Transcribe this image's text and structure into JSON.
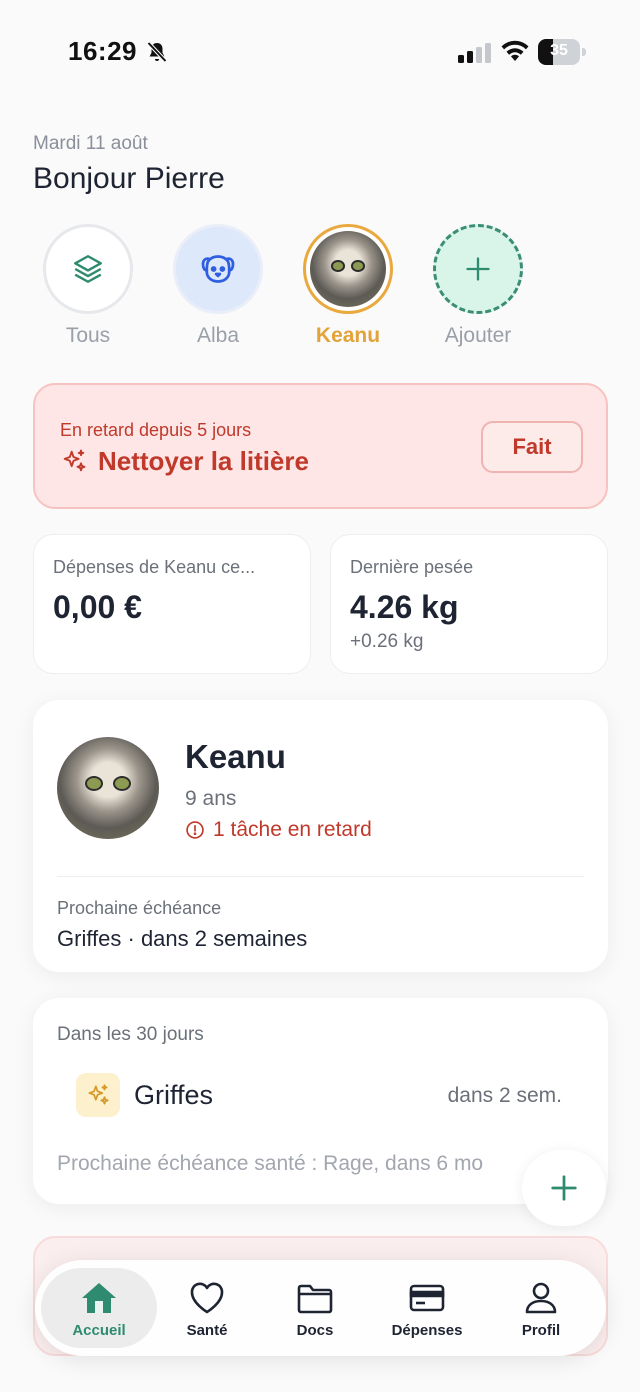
{
  "status_bar": {
    "time": "16:29",
    "battery": "35",
    "battery_level": 0.35
  },
  "header": {
    "date": "Mardi 11 août",
    "greeting": "Bonjour Pierre"
  },
  "pets": [
    {
      "label": "Tous",
      "icon": "layers-icon",
      "active": false
    },
    {
      "label": "Alba",
      "icon": "dog-face-icon",
      "active": false
    },
    {
      "label": "Keanu",
      "icon": "cat-photo",
      "active": true
    },
    {
      "label": "Ajouter",
      "icon": "plus-icon",
      "active": false
    }
  ],
  "alert": {
    "subtitle": "En retard depuis 5 jours",
    "title": "Nettoyer la litière",
    "icon": "sparkles-icon",
    "button": "Fait"
  },
  "stats": [
    {
      "label": "Dépenses de Keanu ce...",
      "value": "0,00 €"
    },
    {
      "label": "Dernière pesée",
      "value": "4.26 kg",
      "delta": "+0.26 kg"
    }
  ],
  "profile": {
    "name": "Keanu",
    "age": "9 ans",
    "warning": "1 tâche en retard",
    "next_label": "Prochaine échéance",
    "next_value": "Griffes · dans 2 semaines"
  },
  "upcoming": {
    "title": "Dans les 30 jours",
    "items": [
      {
        "name": "Griffes",
        "when": "dans 2 sem.",
        "icon": "sparkles-icon"
      }
    ],
    "note": "Prochaine échéance santé : Rage, dans 6 mo"
  },
  "tabs": [
    {
      "label": "Accueil",
      "icon": "home-icon",
      "active": true
    },
    {
      "label": "Santé",
      "icon": "heart-icon",
      "active": false
    },
    {
      "label": "Docs",
      "icon": "folder-icon",
      "active": false
    },
    {
      "label": "Dépenses",
      "icon": "card-icon",
      "active": false
    },
    {
      "label": "Profil",
      "icon": "person-icon",
      "active": false
    }
  ],
  "colors": {
    "accent_green": "#2e8b6f",
    "accent_orange": "#e2a33a",
    "alert_red": "#c0392b",
    "alert_bg": "#fde6e5"
  }
}
